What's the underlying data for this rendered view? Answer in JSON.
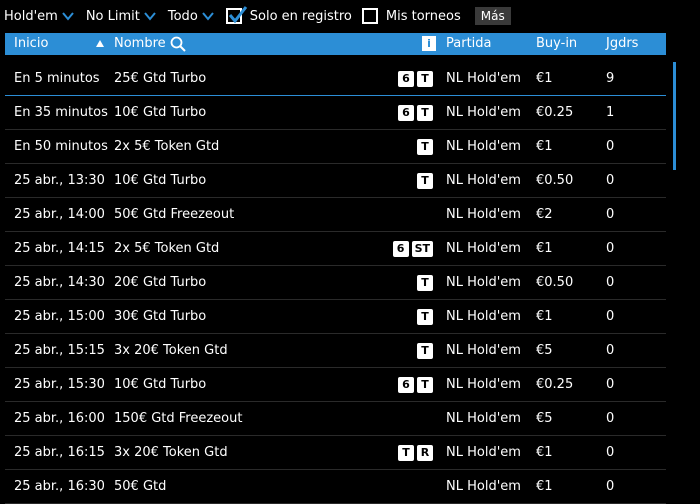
{
  "filters": {
    "game": "Hold'em",
    "limit": "No Limit",
    "all": "Todo",
    "registration_label": "Solo en registro",
    "my_tournaments_label": "Mis torneos",
    "more_label": "Más"
  },
  "columns": {
    "start": "Inicio",
    "name": "Nombre",
    "game": "Partida",
    "buyin": "Buy-in",
    "players": "Jgdrs"
  },
  "rows": [
    {
      "start": "En 5 minutos",
      "name": "25€ Gtd Turbo",
      "badges": [
        "6",
        "T"
      ],
      "game": "NL Hold'em",
      "buyin": "€1",
      "players": "9"
    },
    {
      "start": "En 35 minutos",
      "name": "10€ Gtd Turbo",
      "badges": [
        "6",
        "T"
      ],
      "game": "NL Hold'em",
      "buyin": "€0.25",
      "players": "1"
    },
    {
      "start": "En 50 minutos",
      "name": "2x 5€ Token Gtd",
      "badges": [
        "T"
      ],
      "game": "NL Hold'em",
      "buyin": "€1",
      "players": "0"
    },
    {
      "start": "25 abr., 13:30",
      "name": "10€ Gtd Turbo",
      "badges": [
        "T"
      ],
      "game": "NL Hold'em",
      "buyin": "€0.50",
      "players": "0"
    },
    {
      "start": "25 abr., 14:00",
      "name": "50€ Gtd Freezeout",
      "badges": [],
      "game": "NL Hold'em",
      "buyin": "€2",
      "players": "0"
    },
    {
      "start": "25 abr., 14:15",
      "name": "2x 5€ Token Gtd",
      "badges": [
        "6",
        "ST"
      ],
      "game": "NL Hold'em",
      "buyin": "€1",
      "players": "0"
    },
    {
      "start": "25 abr., 14:30",
      "name": "20€ Gtd Turbo",
      "badges": [
        "T"
      ],
      "game": "NL Hold'em",
      "buyin": "€0.50",
      "players": "0"
    },
    {
      "start": "25 abr., 15:00",
      "name": "30€ Gtd Turbo",
      "badges": [
        "T"
      ],
      "game": "NL Hold'em",
      "buyin": "€1",
      "players": "0"
    },
    {
      "start": "25 abr., 15:15",
      "name": "3x 20€ Token Gtd",
      "badges": [
        "T"
      ],
      "game": "NL Hold'em",
      "buyin": "€5",
      "players": "0"
    },
    {
      "start": "25 abr., 15:30",
      "name": "10€ Gtd Turbo",
      "badges": [
        "6",
        "T"
      ],
      "game": "NL Hold'em",
      "buyin": "€0.25",
      "players": "0"
    },
    {
      "start": "25 abr., 16:00",
      "name": "150€ Gtd Freezeout",
      "badges": [],
      "game": "NL Hold'em",
      "buyin": "€5",
      "players": "0"
    },
    {
      "start": "25 abr., 16:15",
      "name": "3x 20€ Token Gtd",
      "badges": [
        "T",
        "R"
      ],
      "game": "NL Hold'em",
      "buyin": "€1",
      "players": "0"
    },
    {
      "start": "25 abr., 16:30",
      "name": "50€ Gtd",
      "badges": [],
      "game": "NL Hold'em",
      "buyin": "€1",
      "players": "0"
    }
  ],
  "colors": {
    "accent": "#2c8ed6",
    "background": "#000000"
  },
  "icons": {
    "info": "info-icon",
    "search": "search-icon",
    "sort": "sort-up-icon"
  },
  "info_glyph": "i"
}
